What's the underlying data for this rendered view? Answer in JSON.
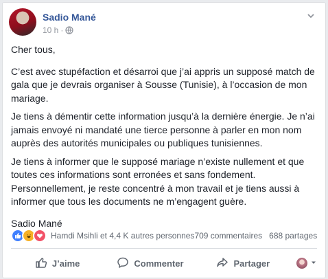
{
  "post": {
    "author": "Sadio Mané",
    "time": "10 h",
    "separator": "·",
    "paragraphs": [
      "Cher tous,",
      "C’est avec stupéfaction et désarroi que j’ai appris un supposé match de gala que je devrais organiser à Sousse (Tunisie), à l’occasion de mon mariage.",
      "Je tiens à démentir cette information jusqu’à la dernière énergie. Je n’ai jamais envoyé ni mandaté une tierce personne à parler en mon nom auprès des autorités municipales ou publiques tunisiennes.",
      "Je tiens à informer que le supposé mariage n’existe nullement et que toutes ces informations sont erronées et sans fondement. Personnellement, je reste concentré à mon travail et je tiens aussi à informer que tous les documents ne m’engagent guère.",
      "Sadio Mané"
    ]
  },
  "reactions": {
    "icons": [
      "like-reaction-icon",
      "haha-reaction-icon",
      "love-reaction-icon"
    ],
    "summary": "Hamdi Msihli et 4,4 K autres personnes",
    "comments": "709 commentaires",
    "shares": "688 partages"
  },
  "actions": {
    "like": "J’aime",
    "comment": "Commenter",
    "share": "Partager"
  },
  "colors": {
    "author": "#365899",
    "meta": "#90949c",
    "like": "#4080ff",
    "haha": "#f7b125",
    "love": "#f25268"
  }
}
